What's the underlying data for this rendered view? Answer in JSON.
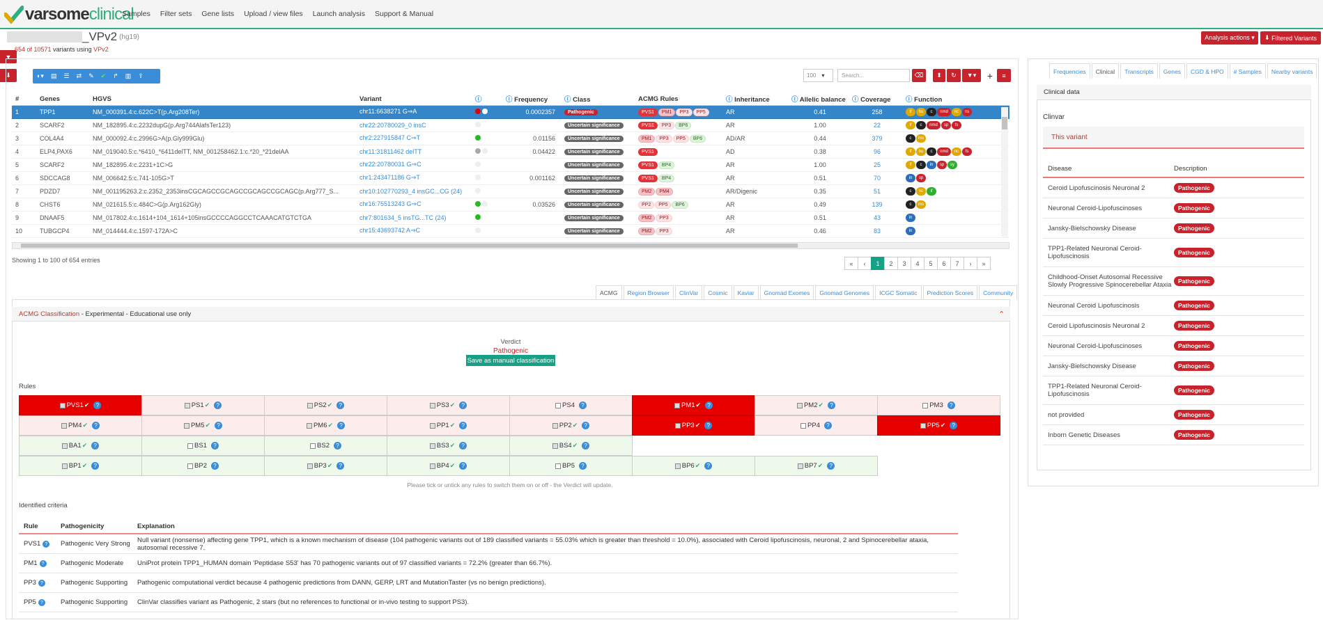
{
  "nav": {
    "logo_dark": "varsome",
    "logo_green": "clinical",
    "links": [
      "Samples",
      "Filter sets",
      "Gene lists",
      "Upload / view files",
      "Launch analysis",
      "Support & Manual"
    ]
  },
  "header": {
    "project_suffix": "_VPv2",
    "assembly": "(hg19)",
    "count_prefix": "654 of 10571",
    "count_mid": " variants using ",
    "count_filter": "VPv2",
    "analysis_actions": "Analysis actions ▾",
    "filtered_variants": "Filtered Variants"
  },
  "controls": {
    "page_size": "100",
    "search_placeholder": "Search..."
  },
  "table": {
    "columns": [
      "#",
      "Genes",
      "HGVS",
      "Variant",
      "",
      "Frequency",
      "Class",
      "ACMG Rules",
      "Inheritance",
      "Allelic balance",
      "Coverage",
      "Function"
    ],
    "rows": [
      {
        "n": "1",
        "gene": "TPP1",
        "hgvs": "NM_000391.4:c.622C>T(p.Arg208Ter)",
        "variant": "chr11:6638271 G⇒A",
        "freq": "0.0002357",
        "cls": "Pathogenic",
        "rules": [
          [
            "PVS1",
            "strong"
          ],
          [
            "PM1",
            "mod"
          ],
          [
            "PP3",
            "sup"
          ],
          [
            "PP5",
            "sup"
          ]
        ],
        "inh": "AR",
        "ab": "0.41",
        "cov": "258",
        "dots": [
          "#e60000",
          "#fff"
        ],
        "fn": [
          [
            "lf",
            "#e0a800"
          ],
          [
            "bu",
            "#e0a800"
          ],
          [
            "c",
            "#222"
          ],
          [
            "nmd",
            "#c8222c"
          ],
          [
            "nc",
            "#e0a800"
          ],
          [
            "ns",
            "#c8222c"
          ]
        ]
      },
      {
        "n": "2",
        "gene": "SCARF2",
        "hgvs": "NM_182895.4:c.2232dupG(p.Arg744AlafsTer123)",
        "variant": "chr22:20780029_0 insC",
        "freq": "",
        "cls": "Uncertain significance",
        "rules": [
          [
            "PVS1",
            "strong"
          ],
          [
            "PP3",
            "sup"
          ],
          [
            "BP6",
            "ben"
          ]
        ],
        "inh": "AR",
        "ab": "1.00",
        "cov": "22",
        "dots": [
          "#eee"
        ],
        "fn": [
          [
            "lf",
            "#e0a800"
          ],
          [
            "c",
            "#222"
          ],
          [
            "nmd",
            "#c8222c"
          ],
          [
            "sp",
            "#c8222c"
          ],
          [
            "fs",
            "#c8222c"
          ]
        ]
      },
      {
        "n": "3",
        "gene": "COL4A4",
        "hgvs": "NM_000092.4:c.2996G>A(p.Gly999Glu)",
        "variant": "chr2:227915847 C⇒T",
        "freq": "0.01156",
        "cls": "Uncertain significance",
        "rules": [
          [
            "PM1",
            "mod"
          ],
          [
            "PP3",
            "sup"
          ],
          [
            "PP5",
            "sup"
          ],
          [
            "BP6",
            "ben"
          ]
        ],
        "inh": "AD/AR",
        "ab": "0.44",
        "cov": "379",
        "dots": [
          "#22bb22"
        ],
        "fn": [
          [
            "c",
            "#222"
          ],
          [
            "ms",
            "#e0a800"
          ]
        ]
      },
      {
        "n": "4",
        "gene": "ELP4,PAX6",
        "hgvs": "NM_019040.5:c.*6410_*6411delTT, NM_001258462.1:c.*20_*21delAA",
        "variant": "chr11:31811462 delTT",
        "freq": "0.04422",
        "cls": "Uncertain significance",
        "rules": [
          [
            "PVS1",
            "strong"
          ]
        ],
        "inh": "AD",
        "ab": "0.38",
        "cov": "96",
        "dots": [
          "#aaa",
          "#eee"
        ],
        "fn": [
          [
            "lf",
            "#e0a800"
          ],
          [
            "bu",
            "#e0a800"
          ],
          [
            "c",
            "#222"
          ],
          [
            "nmd",
            "#c8222c"
          ],
          [
            "nc",
            "#e0a800"
          ],
          [
            "fs",
            "#c8222c"
          ]
        ]
      },
      {
        "n": "5",
        "gene": "SCARF2",
        "hgvs": "NM_182895.4:c.2231+1C>G",
        "variant": "chr22:20780031 G⇒C",
        "freq": "",
        "cls": "Uncertain significance",
        "rules": [
          [
            "PVS1",
            "strong"
          ],
          [
            "BP4",
            "ben"
          ]
        ],
        "inh": "AR",
        "ab": "1.00",
        "cov": "25",
        "dots": [
          "#eee"
        ],
        "fn": [
          [
            "lf",
            "#e0a800"
          ],
          [
            "c",
            "#222"
          ],
          [
            "in",
            "#2a6fbf"
          ],
          [
            "sp",
            "#c8222c"
          ],
          [
            "sy",
            "#2fae2f"
          ]
        ]
      },
      {
        "n": "6",
        "gene": "SDCCAG8",
        "hgvs": "NM_006642.5:c.741-105G>T",
        "variant": "chr1:243471186 G⇒T",
        "freq": "0.001162",
        "cls": "Uncertain significance",
        "rules": [
          [
            "PVS1",
            "strong"
          ],
          [
            "BP4",
            "ben"
          ]
        ],
        "inh": "AR",
        "ab": "0.51",
        "cov": "70",
        "dots": [
          "#eee"
        ],
        "fn": [
          [
            "in",
            "#2a6fbf"
          ],
          [
            "sp",
            "#c8222c"
          ]
        ]
      },
      {
        "n": "7",
        "gene": "PDZD7",
        "hgvs": "NM_001195263.2:c.2352_2353insCGCAGCCGCAGCCGCAGCCGCAGC(p.Arg777_S...",
        "variant": "chr10:102770293_4 insGC...CG (24)",
        "freq": "",
        "cls": "Uncertain significance",
        "rules": [
          [
            "PM2",
            "mod"
          ],
          [
            "PM4",
            "mod"
          ]
        ],
        "inh": "AR/Digenic",
        "ab": "0.35",
        "cov": "51",
        "dots": [
          "#eee"
        ],
        "fn": [
          [
            "c",
            "#222"
          ],
          [
            "nc",
            "#e0a800"
          ],
          [
            "if",
            "#2fae2f"
          ]
        ]
      },
      {
        "n": "8",
        "gene": "CHST6",
        "hgvs": "NM_021615.5:c.484C>G(p.Arg162Gly)",
        "variant": "chr16:75513243 G⇒C",
        "freq": "0.03526",
        "cls": "Uncertain significance",
        "rules": [
          [
            "PP2",
            "sup"
          ],
          [
            "PP5",
            "sup"
          ],
          [
            "BP6",
            "ben"
          ]
        ],
        "inh": "AR",
        "ab": "0.49",
        "cov": "139",
        "dots": [
          "#22bb22",
          "#eee"
        ],
        "fn": [
          [
            "c",
            "#222"
          ],
          [
            "ms",
            "#e0a800"
          ]
        ]
      },
      {
        "n": "9",
        "gene": "DNAAF5",
        "hgvs": "NM_017802.4:c.1614+104_1614+105insGCCCCAGGCCTCAAACATGTCTGA",
        "variant": "chr7:801634_5 insTG...TC (24)",
        "freq": "",
        "cls": "Uncertain significance",
        "rules": [
          [
            "PM2",
            "mod"
          ],
          [
            "PP3",
            "sup"
          ]
        ],
        "inh": "AR",
        "ab": "0.51",
        "cov": "43",
        "dots": [
          "#22bb22"
        ],
        "fn": [
          [
            "in",
            "#2a6fbf"
          ]
        ]
      },
      {
        "n": "10",
        "gene": "TUBGCP4",
        "hgvs": "NM_014444.4:c.1597-172A>C",
        "variant": "chr15:43693742 A⇒C",
        "freq": "",
        "cls": "Uncertain significance",
        "rules": [
          [
            "PM2",
            "mod"
          ],
          [
            "PP3",
            "sup"
          ]
        ],
        "inh": "AR",
        "ab": "0.46",
        "cov": "83",
        "dots": [
          "#eee"
        ],
        "fn": [
          [
            "in",
            "#2a6fbf"
          ]
        ]
      }
    ]
  },
  "showing": "Showing 1 to 100 of 654 entries",
  "pager": [
    "«",
    "‹",
    "1",
    "2",
    "3",
    "4",
    "5",
    "6",
    "7",
    "›",
    "»"
  ],
  "lower_tabs": [
    "ACMG",
    "Region Browser",
    "ClinVar",
    "Cosmic",
    "Kaviar",
    "Gnomad Exomes",
    "Gnomad Genomes",
    "ICGC Somatic",
    "Prediction Scores",
    "Community"
  ],
  "acmg": {
    "title_red": "ACMG Classification",
    "title_rest": " - Experimental - Educational use only",
    "verdict_label": "Verdict",
    "verdict_value": "Pathogenic",
    "save_button": "Save as manual classification",
    "rules_label": "Rules",
    "rules": [
      [
        [
          "PVS1",
          "red"
        ],
        [
          "PS1",
          "pink"
        ],
        [
          "PS2",
          "pink"
        ],
        [
          "PS3",
          "pink"
        ],
        [
          "PS4",
          "pink"
        ],
        [
          "PM1",
          "red"
        ],
        [
          "PM2",
          "pink"
        ],
        [
          "PM3",
          "pink"
        ]
      ],
      [
        [
          "PM4",
          "pink"
        ],
        [
          "PM5",
          "pink"
        ],
        [
          "PM6",
          "pink"
        ],
        [
          "PP1",
          "pink"
        ],
        [
          "PP2",
          "pink"
        ],
        [
          "PP3",
          "red"
        ],
        [
          "PP4",
          "pink"
        ],
        [
          "PP5",
          "red"
        ]
      ],
      [
        [
          "BA1",
          "green"
        ],
        [
          "BS1",
          "green"
        ],
        [
          "BS2",
          "green"
        ],
        [
          "BS3",
          "green"
        ],
        [
          "BS4",
          "green"
        ]
      ],
      [
        [
          "BP1",
          "green"
        ],
        [
          "BP2",
          "green"
        ],
        [
          "BP3",
          "green"
        ],
        [
          "BP4",
          "green"
        ],
        [
          "BP5",
          "green"
        ],
        [
          "BP6",
          "green"
        ],
        [
          "BP7",
          "green"
        ]
      ]
    ],
    "rule_checks": [
      [
        true,
        true,
        true,
        true,
        false,
        true,
        true,
        false
      ],
      [
        true,
        true,
        true,
        true,
        true,
        true,
        false,
        true
      ],
      [
        true,
        false,
        false,
        true,
        true
      ],
      [
        true,
        false,
        true,
        true,
        false,
        true,
        true
      ]
    ],
    "hint": "Please tick or untick any rules to switch them on or off - the Verdict will update.",
    "identified_label": "Identified criteria",
    "criteria_columns": [
      "Rule",
      "Pathogenicity",
      "Explanation"
    ],
    "criteria": [
      {
        "rule": "PVS1",
        "path": "Pathogenic Very Strong",
        "expl": "Null variant (nonsense) affecting gene TPP1, which is a known mechanism of disease (104 pathogenic variants out of 189 classified variants = 55.03% which is greater than threshold = 10.0%), associated with Ceroid lipofuscinosis, neuronal, 2 and Spinocerebellar ataxia, autosomal recessive 7."
      },
      {
        "rule": "PM1",
        "path": "Pathogenic Moderate",
        "expl": "UniProt protein TPP1_HUMAN domain 'Peptidase S53' has 70 pathogenic variants out of 97 classified variants = 72.2% (greater than 66.7%)."
      },
      {
        "rule": "PP3",
        "path": "Pathogenic Supporting",
        "expl": "Pathogenic computational verdict because 4 pathogenic predictions from DANN, GERP, LRT and MutationTaster (vs no benign predictions)."
      },
      {
        "rule": "PP5",
        "path": "Pathogenic Supporting",
        "expl": "ClinVar classifies variant as Pathogenic, 2 stars (but no references to functional or in-vivo testing to support PS3)."
      }
    ]
  },
  "right_tabs": [
    "Frequencies",
    "Clinical",
    "Transcripts",
    "Genes",
    "CGD & HPO",
    "# Samples",
    "Nearby variants"
  ],
  "clinical": {
    "header": "Clinical data",
    "clinvar": "Clinvar",
    "this_variant": "This variant",
    "columns": [
      "Disease",
      "Description"
    ],
    "diseases": [
      {
        "name": "Ceroid Lipofuscinosis Neuronal 2",
        "desc": "Pathogenic",
        "h": 29
      },
      {
        "name": "Neuronal Ceroid-Lipofuscinoses",
        "desc": "Pathogenic",
        "h": 29
      },
      {
        "name": "Jansky-Bielschowsky Disease",
        "desc": "Pathogenic",
        "h": 29
      },
      {
        "name": "TPP1-Related Neuronal Ceroid-Lipofuscinosis",
        "desc": "Pathogenic",
        "h": 41
      },
      {
        "name": "Childhood-Onset Autosomal Recessive Slowly Progressive Spinocerebellar Ataxia",
        "desc": "Pathogenic",
        "h": 41
      },
      {
        "name": "Neuronal Ceroid Lipofuscinosis",
        "desc": "Pathogenic",
        "h": 29
      },
      {
        "name": "Ceroid Lipofuscinosis Neuronal 2",
        "desc": "Pathogenic",
        "h": 29
      },
      {
        "name": "Neuronal Ceroid-Lipofuscinoses",
        "desc": "Pathogenic",
        "h": 29
      },
      {
        "name": "Jansky-Bielschowsky Disease",
        "desc": "Pathogenic",
        "h": 29
      },
      {
        "name": "TPP1-Related Neuronal Ceroid-Lipofuscinosis",
        "desc": "Pathogenic",
        "h": 41
      },
      {
        "name": "not provided",
        "desc": "Pathogenic",
        "h": 29
      },
      {
        "name": "Inborn Genetic Diseases",
        "desc": "Pathogenic",
        "h": 29
      }
    ]
  }
}
